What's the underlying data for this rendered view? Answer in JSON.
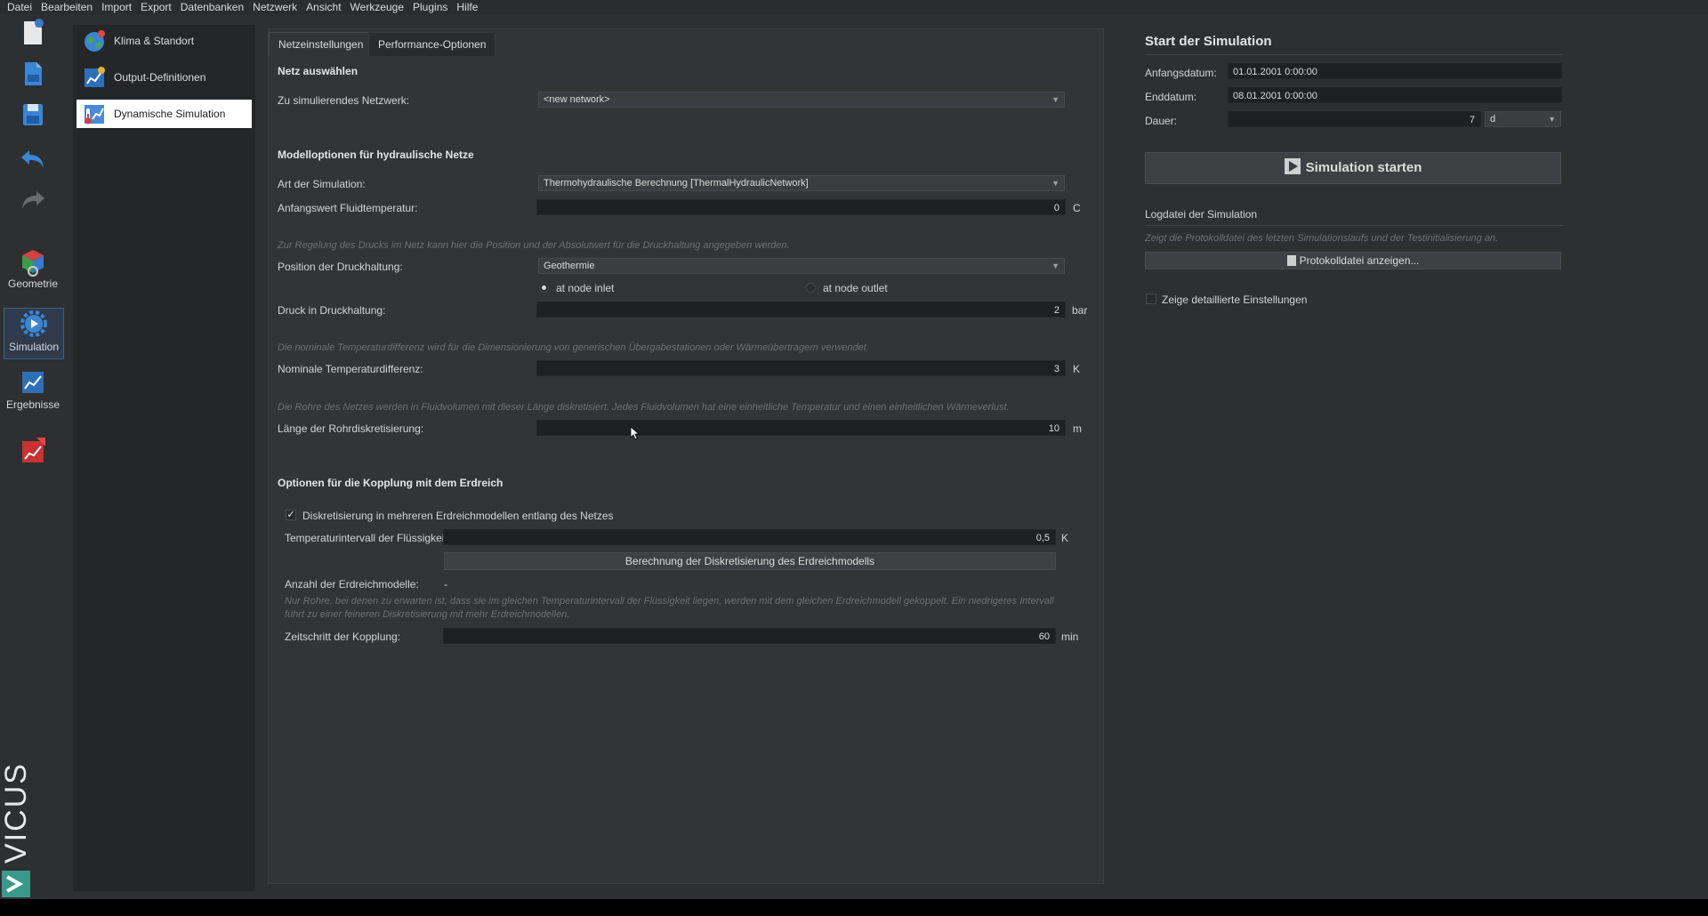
{
  "menu": [
    "Datei",
    "Bearbeiten",
    "Import",
    "Export",
    "Datenbanken",
    "Netzwerk",
    "Ansicht",
    "Werkzeuge",
    "Plugins",
    "Hilfe"
  ],
  "toolbar": {
    "geometry_label": "Geometrie",
    "simulation_label": "Simulation",
    "results_label": "Ergebnisse"
  },
  "nav": {
    "items": [
      {
        "label": "Klima & Standort",
        "icon": "globe-icon"
      },
      {
        "label": "Output-Definitionen",
        "icon": "chart-icon"
      },
      {
        "label": "Dynamische Simulation",
        "icon": "thermometer-icon"
      }
    ]
  },
  "tabs": [
    "Netzeinstellungen",
    "Performance-Optionen"
  ],
  "net_select": {
    "heading": "Netz auswählen",
    "network_label": "Zu simulierendes Netzwerk:",
    "network_value": "<new network>"
  },
  "hydraulic": {
    "heading": "Modelloptionen für hydraulische Netze",
    "sim_type_label": "Art der Simulation:",
    "sim_type_value": "Thermohydraulische Berechnung [ThermalHydraulicNetwork]",
    "fluid_temp_label": "Anfangswert Fluidtemperatur:",
    "fluid_temp_value": "0",
    "fluid_temp_unit": "C",
    "pressure_hint": "Zur Regelung des Drucks im Netz kann hier die Position und der Absolutwert für die Druckhaltung angegeben werden.",
    "pressure_pos_label": "Position der Druckhaltung:",
    "pressure_pos_value": "Geothermie",
    "radio_inlet": "at node inlet",
    "radio_outlet": "at node outlet",
    "pressure_label": "Druck in Druckhaltung:",
    "pressure_value": "2",
    "pressure_unit": "bar",
    "temp_diff_hint": "Die nominale Temperaturdifferenz wird für die Dimensionierung von generischen Übergabestationen oder Wärmeübertragern verwendet.",
    "temp_diff_label": "Nominale Temperaturdifferenz:",
    "temp_diff_value": "3",
    "temp_diff_unit": "K",
    "discretization_hint": "Die Rohre des Netzes werden in Fluidvolumen mit dieser Länge diskretisiert. Jedes Fluidvolumen hat eine einheitliche Temperatur und einen einheitlichen Wärmeverlust.",
    "discretization_label": "Länge der Rohrdiskretisierung:",
    "discretization_value": "10",
    "discretization_unit": "m"
  },
  "soil": {
    "heading": "Optionen für die Kopplung mit dem Erdreich",
    "checkbox_label": "Diskretisierung in mehreren Erdreichmodellen entlang des Netzes",
    "checkbox_checked": true,
    "interval_label": "Temperaturintervall der Flüssigkeit:",
    "interval_value": "0,5",
    "interval_unit": "K",
    "calc_button": "Berechnung der Diskretisierung des Erdreichmodells",
    "count_label": "Anzahl der Erdreichmodelle:",
    "count_value": "-",
    "hint_line1": "Nur Rohre, bei denen zu erwarten ist, dass sie im gleichen Temperaturintervall der Flüssigkeit liegen, werden mit dem gleichen Erdreichmodell gekoppelt. Ein niedrigeres Intervall",
    "hint_line2": "führt zu einer feineren Diskretisierung mit mehr Erdreichmodellen.",
    "timestep_label": "Zeitschritt der Kopplung:",
    "timestep_value": "60",
    "timestep_unit": "min"
  },
  "sim_start": {
    "heading": "Start der Simulation",
    "start_label": "Anfangsdatum:",
    "start_value": "01.01.2001  0:00:00",
    "end_label": "Enddatum:",
    "end_value": "08.01.2001  0:00:00",
    "duration_label": "Dauer:",
    "duration_value": "7",
    "duration_unit": "d",
    "start_button": "Simulation starten",
    "log_heading": "Logdatei der Simulation",
    "log_hint": "Zeigt die Protokolldatei des letzten Simulationslaufs und der Testinitialisierung an.",
    "log_button": "Protokolldatei anzeigen...",
    "detail_checkbox": "Zeige detaillierte Einstellungen"
  },
  "brand": "VICUS"
}
